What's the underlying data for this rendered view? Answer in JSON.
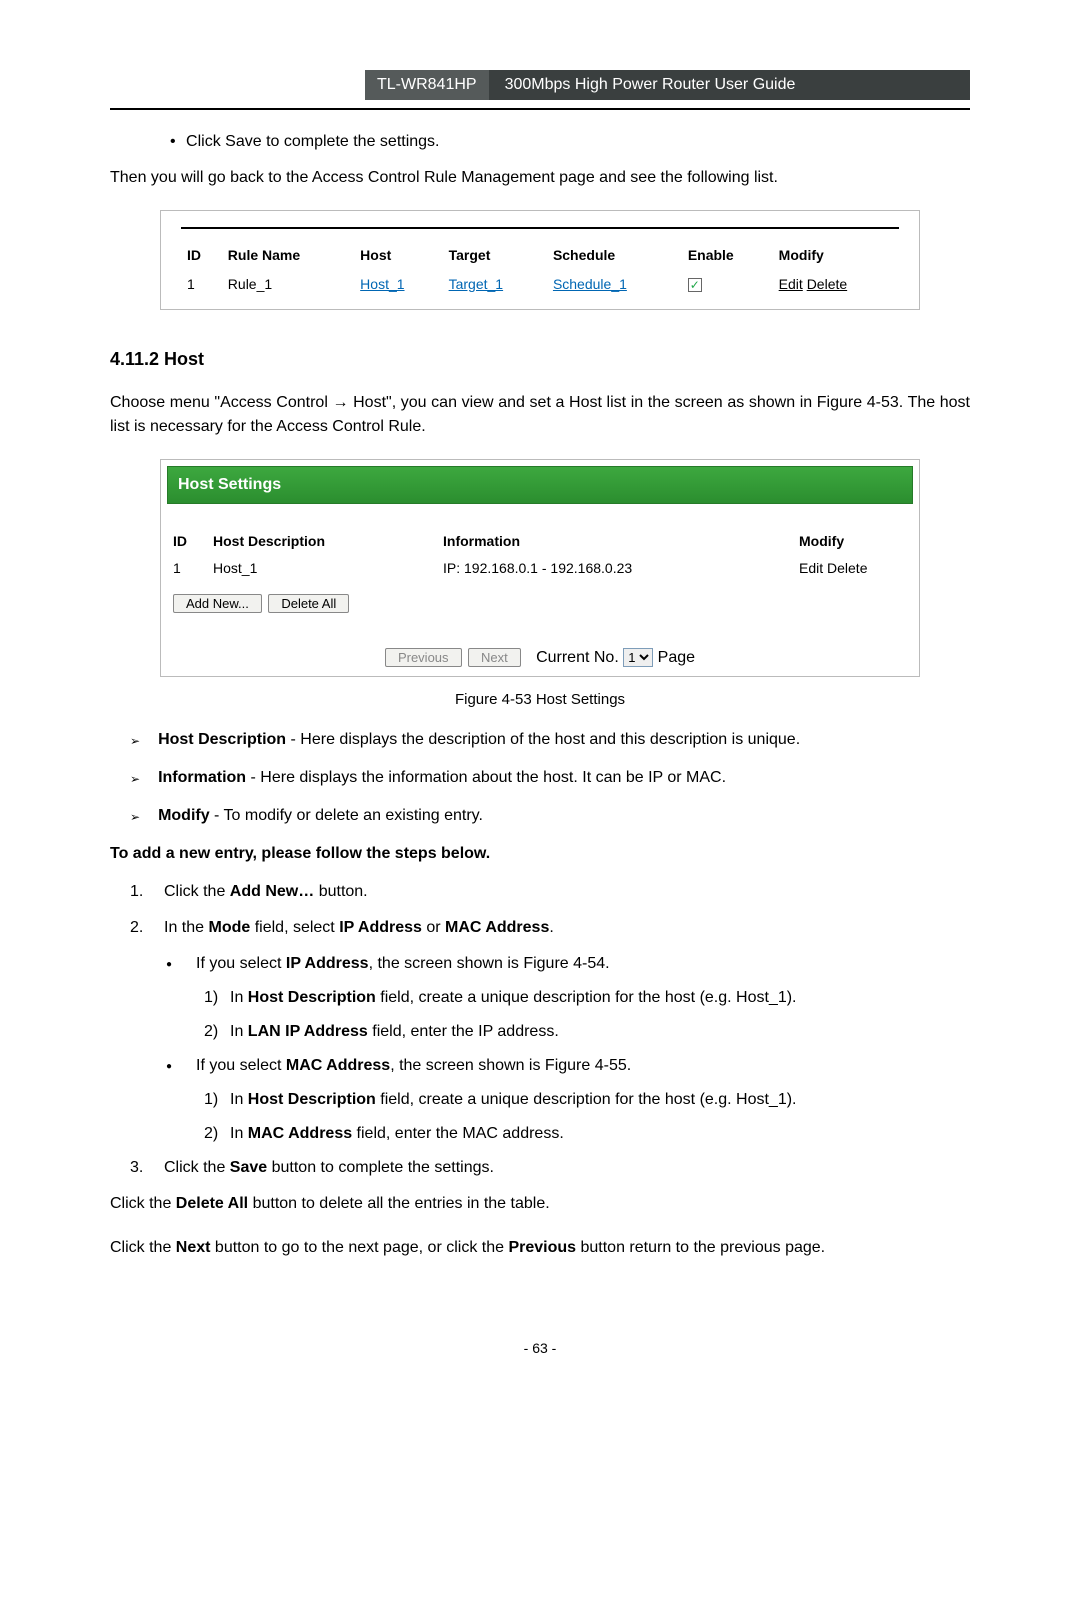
{
  "header": {
    "model": "TL-WR841HP",
    "title": "300Mbps High Power Router User Guide"
  },
  "intro": {
    "bullet": "Click Save to complete the settings.",
    "back_text": "Then you will go back to the Access Control Rule Management page and see the following list."
  },
  "rule_table": {
    "headers": {
      "id": "ID",
      "rule_name": "Rule Name",
      "host": "Host",
      "target": "Target",
      "schedule": "Schedule",
      "enable": "Enable",
      "modify": "Modify"
    },
    "row": {
      "id": "1",
      "rule_name": "Rule_1",
      "host": "Host_1",
      "target": "Target_1",
      "schedule": "Schedule_1",
      "edit": "Edit",
      "delete": "Delete"
    }
  },
  "section": {
    "heading": "4.11.2 Host",
    "para": "Choose menu \"Access Control → Host\", you can view and set a Host list in the screen as shown in Figure 4-53. The host list is necessary for the Access Control Rule."
  },
  "host_box": {
    "title": "Host Settings",
    "headers": {
      "id": "ID",
      "desc": "Host Description",
      "info": "Information",
      "modify": "Modify"
    },
    "row": {
      "id": "1",
      "desc": "Host_1",
      "info": "IP: 192.168.0.1 - 192.168.0.23",
      "edit": "Edit",
      "delete": "Delete"
    },
    "buttons": {
      "add": "Add New...",
      "delete_all": "Delete All",
      "prev": "Previous",
      "next": "Next"
    },
    "pager": {
      "current": "Current No.",
      "value": "1",
      "page": "Page"
    }
  },
  "figure_caption": "Figure 4-53    Host Settings",
  "bullets": {
    "b1_bold": "Host Description",
    "b1_rest": " - Here displays the description of the host and this description is unique.",
    "b2_bold": "Information",
    "b2_rest": " - Here displays the information about the host. It can be IP or MAC.",
    "b3_bold": "Modify",
    "b3_rest": " - To modify or delete an existing entry."
  },
  "steps": {
    "intro_bold": "To add a new entry, please follow the steps below.",
    "s1_pre": "Click the ",
    "s1_bold": "Add New…",
    "s1_post": " button.",
    "s2_pre": "In the ",
    "s2_bold": "Mode",
    "s2_mid": " field, select ",
    "s2_bold2": "IP Address",
    "s2_mid2": " or ",
    "s2_bold3": "MAC Address",
    "s2_post": ".",
    "ip_pre": "If you select ",
    "ip_bold": "IP Address",
    "ip_post": ", the screen shown is Figure 4-54.",
    "ip1_pre": "In ",
    "ip1_bold": "Host Description",
    "ip1_post": " field, create a unique description for the host (e.g. Host_1).",
    "ip2_pre": "In ",
    "ip2_bold": "LAN IP Address",
    "ip2_post": " field, enter the IP address.",
    "mac_pre": "If you select ",
    "mac_bold": "MAC Address",
    "mac_post": ", the screen shown is Figure 4-55.",
    "mac1_pre": "In ",
    "mac1_bold": "Host Description",
    "mac1_post": " field, create a unique description for the host (e.g. Host_1).",
    "mac2_pre": "In ",
    "mac2_bold": "MAC Address",
    "mac2_post": " field, enter the MAC address.",
    "s3_pre": "Click the ",
    "s3_bold": "Save",
    "s3_post": " button to complete the settings."
  },
  "tail": {
    "del_pre": "Click the ",
    "del_bold": "Delete All",
    "del_post": " button to delete all the entries in the table.",
    "next_pre": "Click the ",
    "next_bold": "Next",
    "next_mid": " button to go to the next page, or click the ",
    "next_bold2": "Previous",
    "next_post": " button return to the previous page."
  },
  "footer": "- 63 -"
}
